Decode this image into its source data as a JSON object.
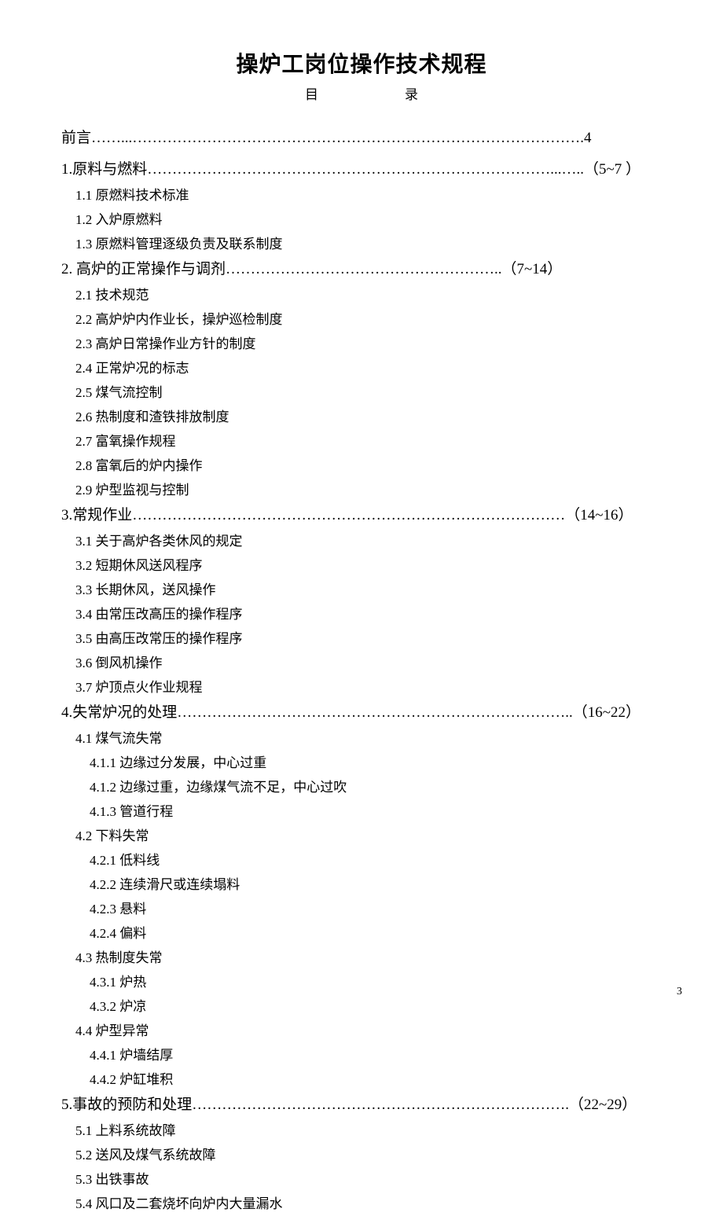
{
  "title": "操炉工岗位操作技术规程",
  "subtitle_left": "目",
  "subtitle_right": "录",
  "page_number": "3",
  "entries": [
    {
      "level": "preface",
      "label": "前言",
      "leader": "……...……………………………………………………………………………….",
      "page": "4"
    },
    {
      "level": "top",
      "label": "1.原料与燃料",
      "leader": "………………………………………………………………………...…..",
      "page": "（5~7 ）"
    },
    {
      "level": "lvl2",
      "label": "1.1 原燃料技术标准"
    },
    {
      "level": "lvl2",
      "label": "1.2 入炉原燃料"
    },
    {
      "level": "lvl2",
      "label": "1.3 原燃料管理逐级负责及联系制度"
    },
    {
      "level": "top",
      "label": "2.  高炉的正常操作与调剂",
      "leader": "………………………………………………..",
      "page": "（7~14）"
    },
    {
      "level": "lvl2",
      "label": "2.1 技术规范"
    },
    {
      "level": "lvl2",
      "label": "2.2 高炉炉内作业长，操炉巡检制度"
    },
    {
      "level": "lvl2",
      "label": "2.3 高炉日常操作业方针的制度"
    },
    {
      "level": "lvl2",
      "label": "2.4 正常炉况的标志"
    },
    {
      "level": "lvl2",
      "label": "2.5 煤气流控制"
    },
    {
      "level": "lvl2",
      "label": "2.6 热制度和渣铁排放制度"
    },
    {
      "level": "lvl2",
      "label": "2.7 富氧操作规程"
    },
    {
      "level": "lvl2",
      "label": "2.8 富氧后的炉内操作"
    },
    {
      "level": "lvl2",
      "label": "2.9 炉型监视与控制"
    },
    {
      "level": "top",
      "label": "3.常规作业",
      "leader": "……………………………………………………………………………",
      "page": "（14~16）"
    },
    {
      "level": "lvl2",
      "label": "3.1 关于高炉各类休风的规定"
    },
    {
      "level": "lvl2",
      "label": "3.2 短期休风送风程序"
    },
    {
      "level": "lvl2",
      "label": "3.3 长期休风，送风操作"
    },
    {
      "level": "lvl2",
      "label": "3.4 由常压改高压的操作程序"
    },
    {
      "level": "lvl2",
      "label": "3.5 由高压改常压的操作程序"
    },
    {
      "level": "lvl2",
      "label": "3.6 倒风机操作"
    },
    {
      "level": "lvl2",
      "label": "3.7 炉顶点火作业规程"
    },
    {
      "level": "top",
      "label": "4.失常炉况的处理",
      "leader": "……………………………………………………………………..",
      "page": "（16~22）"
    },
    {
      "level": "lvl2",
      "label": "4.1 煤气流失常"
    },
    {
      "level": "lvl3",
      "label": "4.1.1 边缘过分发展，中心过重"
    },
    {
      "level": "lvl3",
      "label": "4.1.2 边缘过重，边缘煤气流不足，中心过吹"
    },
    {
      "level": "lvl3",
      "label": "4.1.3 管道行程"
    },
    {
      "level": "lvl2",
      "label": "4.2 下料失常"
    },
    {
      "level": "lvl3",
      "label": "4.2.1 低料线"
    },
    {
      "level": "lvl3",
      "label": "4.2.2 连续滑尺或连续塌料"
    },
    {
      "level": "lvl3",
      "label": "4.2.3 悬料"
    },
    {
      "level": "lvl3",
      "label": "4.2.4 偏料"
    },
    {
      "level": "lvl2",
      "label": "4.3 热制度失常"
    },
    {
      "level": "lvl3",
      "label": "4.3.1 炉热"
    },
    {
      "level": "lvl3",
      "label": "4.3.2 炉凉"
    },
    {
      "level": "lvl2",
      "label": "4.4 炉型异常"
    },
    {
      "level": "lvl3",
      "label": "4.4.1 炉墙结厚"
    },
    {
      "level": "lvl3",
      "label": "4.4.2 炉缸堆积"
    },
    {
      "level": "top",
      "label": "5.事故的预防和处理",
      "leader": "………………………………………………………………….",
      "page": "（22~29）"
    },
    {
      "level": "lvl2",
      "label": "5.1 上料系统故障"
    },
    {
      "level": "lvl2",
      "label": "5.2 送风及煤气系统故障"
    },
    {
      "level": "lvl2",
      "label": "5.3 出铁事故"
    },
    {
      "level": "lvl2",
      "label": "5.4 风口及二套烧坏向炉内大量漏水"
    }
  ]
}
